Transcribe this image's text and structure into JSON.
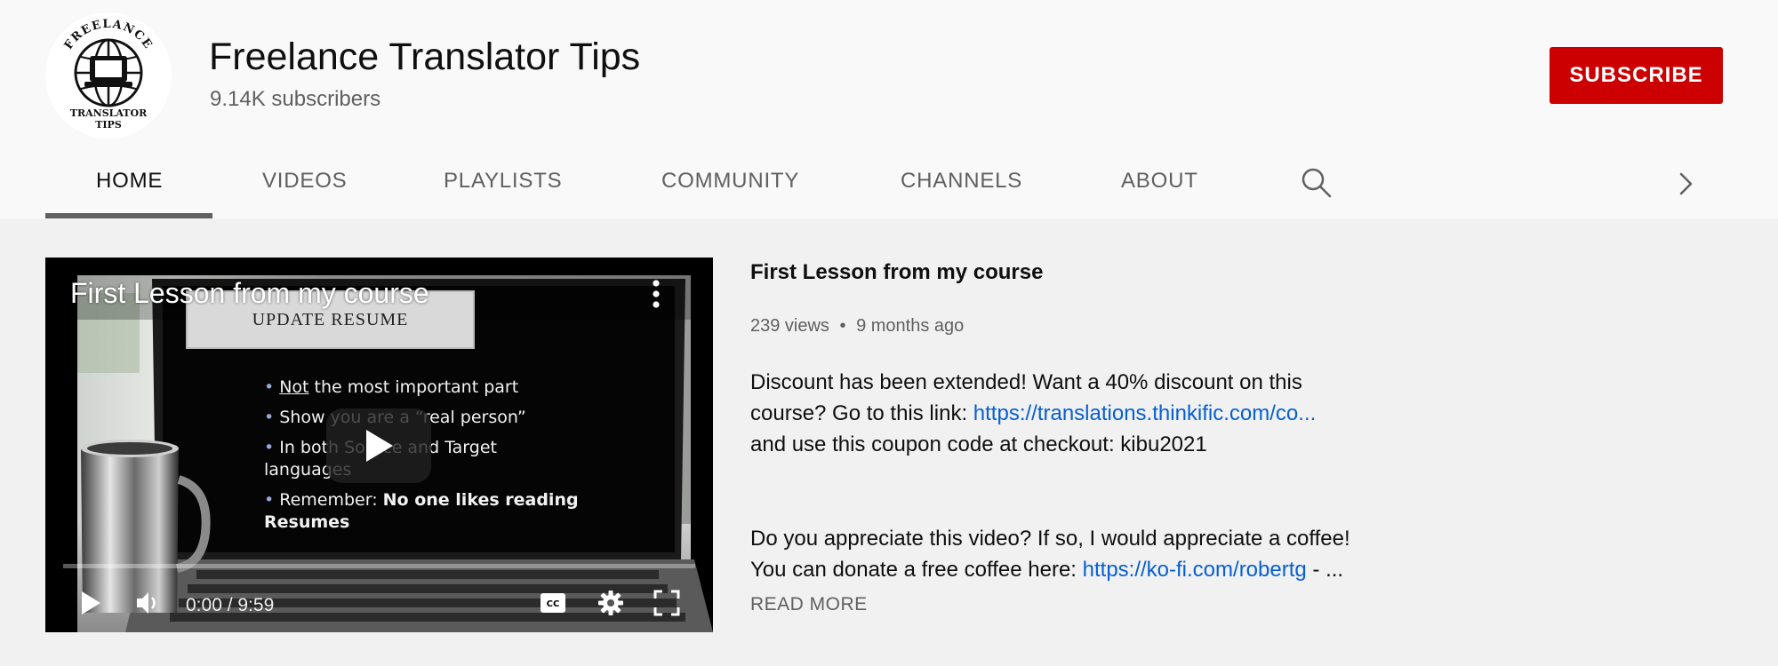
{
  "channel": {
    "name": "Freelance Translator Tips",
    "subscribers": "9.14K subscribers",
    "logo_text_top": "FREELANCE",
    "logo_text_bottom_1": "TRANSLATOR",
    "logo_text_bottom_2": "TIPS",
    "subscribe_label": "SUBSCRIBE"
  },
  "tabs": [
    {
      "label": "HOME",
      "active": true
    },
    {
      "label": "VIDEOS",
      "active": false
    },
    {
      "label": "PLAYLISTS",
      "active": false
    },
    {
      "label": "COMMUNITY",
      "active": false
    },
    {
      "label": "CHANNELS",
      "active": false
    },
    {
      "label": "ABOUT",
      "active": false
    }
  ],
  "tab_icons": {
    "search": "search-icon",
    "next": "chevron-right-icon"
  },
  "player": {
    "title": "First Lesson from my course",
    "slide_heading": "UPDATE RESUME",
    "bullets": {
      "b1_underlined": "Not",
      "b1_rest": " the most important part",
      "b2": "Show you are a “real person”",
      "b3": "In both Source and Target languages",
      "b4_prefix": "Remember: ",
      "b4_bold": "No one likes reading Resumes"
    },
    "time": "0:00 / 9:59",
    "progress": 0,
    "icons": [
      "play-icon",
      "volume-icon",
      "captions-icon",
      "settings-icon",
      "fullscreen-icon",
      "more-vert-icon"
    ]
  },
  "description": {
    "title": "First Lesson from my course",
    "views": "239 views",
    "separator": "•",
    "age": "9 months ago",
    "p1_line1": "Discount has been extended! Want a 40% discount on this",
    "p1_line2_prefix": "course? Go to this link: ",
    "p1_link": "https://translations.thinkific.com/co...",
    "p1_line3": "and use this coupon code at checkout: kibu2021",
    "p2_line1": "Do you appreciate this video? If so, I would appreciate a coffee!",
    "p2_line2_prefix": "You can donate a free coffee here: ",
    "p2_link": "https://ko-fi.com/robertg",
    "p2_suffix": " - ...",
    "read_more": "READ MORE"
  },
  "colors": {
    "brand_red": "#cc0000",
    "link_blue": "#065fd4",
    "header_bg": "#f9f9f9",
    "page_bg": "#f1f1f1"
  }
}
